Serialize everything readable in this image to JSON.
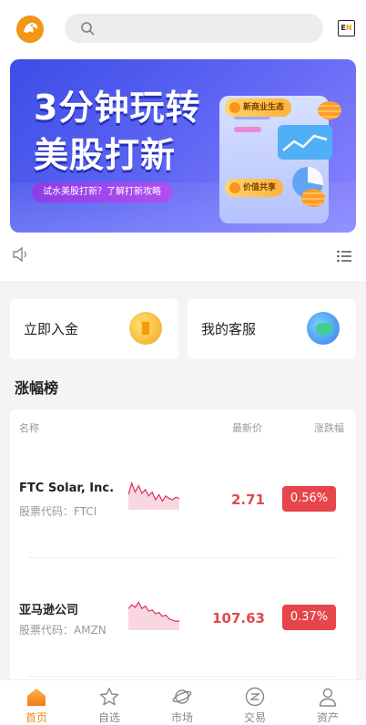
{
  "header": {
    "search_placeholder": "",
    "lang_label_e": "E",
    "lang_label_n": "N",
    "icons": {
      "logo": "lion-logo-icon",
      "search": "search-icon"
    }
  },
  "banner": {
    "title_line1": "3分钟玩转",
    "title_line2": "美股打新",
    "subtitle": "试水美股打新？了解打新攻略",
    "tag1": "新商业生态",
    "tag2": "价值共享"
  },
  "cards": {
    "deposit": "立即入金",
    "service": "我的客服"
  },
  "section_title": "涨幅榜",
  "table": {
    "headers": {
      "name": "名称",
      "price": "最新价",
      "change": "涨跌幅"
    },
    "rows": [
      {
        "name": "FTC Solar, Inc.",
        "code": "股票代码：FTCI",
        "price": "2.71",
        "change": "0.56%",
        "spark": [
          0.55,
          0.1,
          0.45,
          0.2,
          0.5,
          0.35,
          0.6,
          0.45,
          0.75,
          0.55,
          0.8,
          0.6,
          0.7,
          0.75,
          0.65,
          0.7
        ]
      },
      {
        "name": "亚马逊公司",
        "code": "股票代码：AMZN",
        "price": "107.63",
        "change": "0.37%",
        "spark": [
          0.3,
          0.15,
          0.25,
          0.05,
          0.3,
          0.2,
          0.4,
          0.35,
          0.5,
          0.45,
          0.6,
          0.55,
          0.7,
          0.75,
          0.8,
          0.78
        ]
      }
    ]
  },
  "colors": {
    "accent": "#f08a1c",
    "up": "#e6454b",
    "price": "#e04b4b"
  },
  "tabs": [
    {
      "label": "首页",
      "icon": "home-icon",
      "active": true
    },
    {
      "label": "自选",
      "icon": "star-icon",
      "active": false
    },
    {
      "label": "市场",
      "icon": "planet-icon",
      "active": false
    },
    {
      "label": "交易",
      "icon": "trade-icon",
      "active": false
    },
    {
      "label": "资产",
      "icon": "user-icon",
      "active": false
    }
  ]
}
